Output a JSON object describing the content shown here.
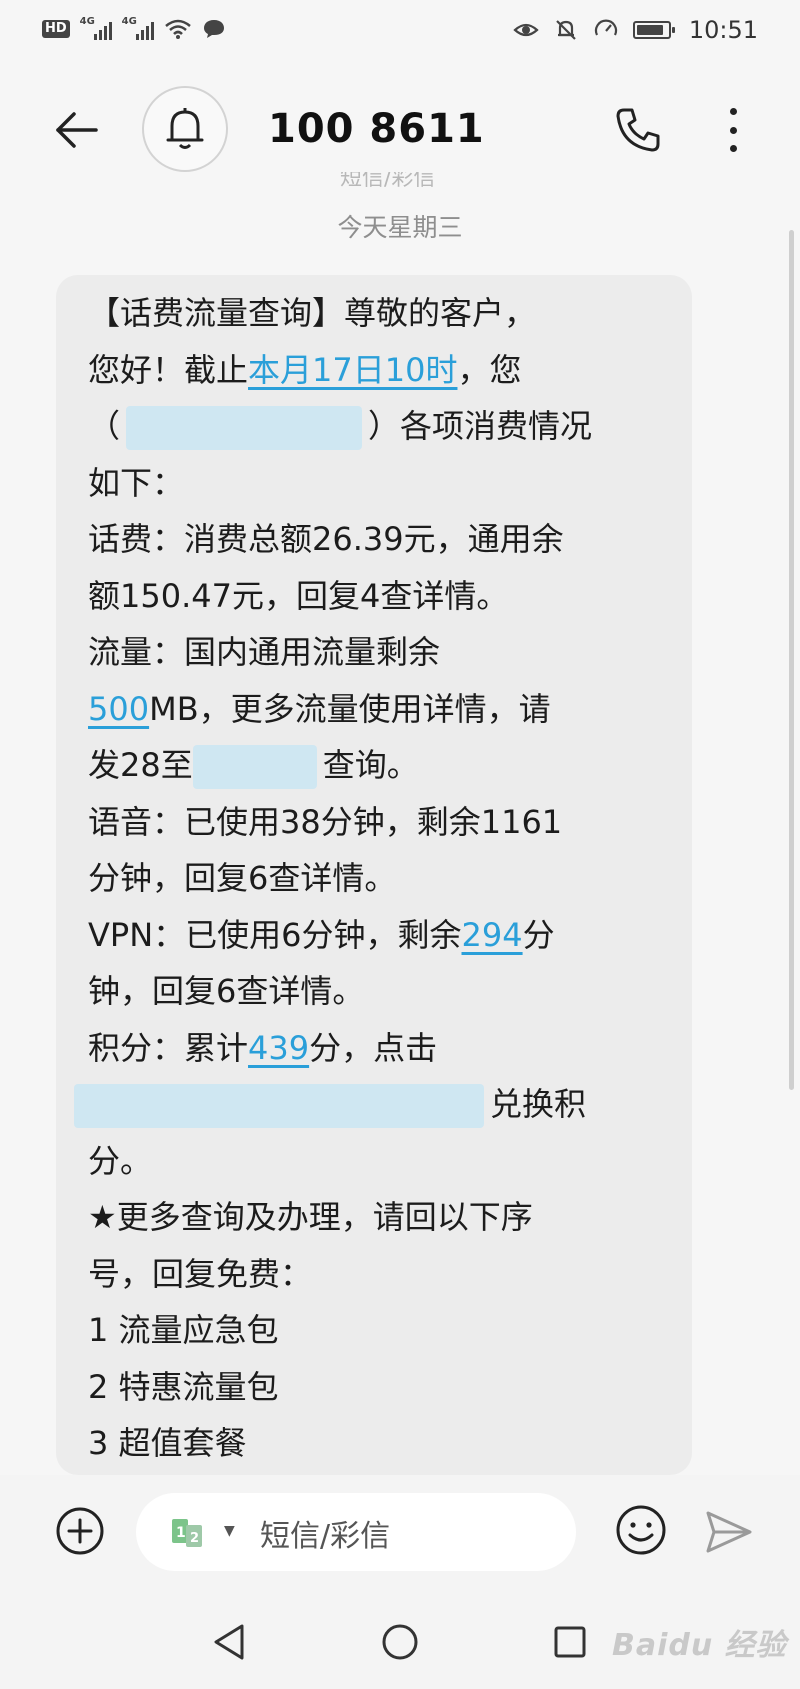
{
  "status_bar": {
    "hd_badge": "HD",
    "network_1": "4G",
    "network_2": "4G",
    "time": "10:51",
    "battery_level": 0.85
  },
  "header": {
    "contact": "100 8611"
  },
  "cutoff_label": "短信/彩信",
  "date_separator": "今天星期三",
  "message": {
    "l1": "【话费流量查询】尊敬的客户，",
    "l2a": "您好！截止",
    "l2_link": "本月17日10时",
    "l2b": "，您",
    "l3a": "（",
    "l3b": "）各项消费情况",
    "l4": "如下：",
    "l5": "话费：消费总额26.39元，通用余",
    "l6": "额150.47元，回复4查详情。",
    "l7": "流量：国内通用流量剩余",
    "l8_link": "500",
    "l8b": "MB，更多流量使用详情，请",
    "l9a": "发28至",
    "l9b": "查询。",
    "l10": "语音：已使用38分钟，剩余1161",
    "l11": "分钟，回复6查详情。",
    "l12a": "VPN：已使用6分钟，剩余",
    "l12_link": "294",
    "l12b": "分",
    "l13": "钟，回复6查详情。",
    "l14a": "积分：累计",
    "l14_link": "439",
    "l14b": "分，点击",
    "l15b": "兑换积",
    "l16": "分。",
    "l17": "★更多查询及办理，请回以下序",
    "l18": "号，回复免费：",
    "l19": "1 流量应急包",
    "l20": "2 特惠流量包",
    "l21": "3 超值套餐"
  },
  "composer": {
    "placeholder": "短信/彩信"
  },
  "watermark": "Baidu 经验",
  "colors": {
    "link": "#2a9fd9",
    "bubble": "#ececec",
    "background": "#f6f6f6"
  },
  "icons": [
    "back-arrow-icon",
    "bell-icon",
    "phone-icon",
    "more-vert-icon",
    "add-circle-icon",
    "sim-card-icon",
    "emoji-icon",
    "send-icon",
    "nav-back-icon",
    "nav-home-icon",
    "nav-recent-icon"
  ]
}
